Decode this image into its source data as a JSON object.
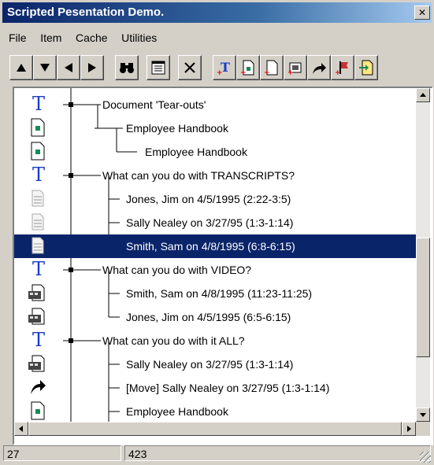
{
  "window": {
    "title": "Scripted Pesentation Demo.",
    "close_label": "✕"
  },
  "menu": [
    "File",
    "Item",
    "Cache",
    "Utilities"
  ],
  "toolbar": [
    {
      "name": "move-up-icon"
    },
    {
      "name": "move-down-icon"
    },
    {
      "name": "move-left-icon"
    },
    {
      "name": "move-right-icon"
    },
    {
      "name": "binoculars-icon"
    },
    {
      "name": "properties-icon"
    },
    {
      "name": "delete-icon"
    },
    {
      "name": "insert-text-icon"
    },
    {
      "name": "insert-document-icon"
    },
    {
      "name": "new-page-icon"
    },
    {
      "name": "insert-video-icon"
    },
    {
      "name": "move-arrow-icon"
    },
    {
      "name": "insert-flag-icon"
    },
    {
      "name": "export-icon"
    }
  ],
  "tree": [
    {
      "label": "Document 'Tear-outs'",
      "icon": "text-icon"
    },
    {
      "label": "Employee Handbook",
      "icon": "document-icon"
    },
    {
      "label": "Employee Handbook",
      "icon": "document-icon"
    },
    {
      "label": "What can you do with TRANSCRIPTS?",
      "icon": "text-icon"
    },
    {
      "label": "Jones, Jim on 4/5/1995 (2:22-3:5)",
      "icon": "transcript-icon"
    },
    {
      "label": "Sally Nealey on 3/27/95 (1:3-1:14)",
      "icon": "transcript-icon"
    },
    {
      "label": "Smith, Sam on 4/8/1995 (6:8-6:15)",
      "icon": "transcript-icon",
      "selected": true
    },
    {
      "label": "What can you do with VIDEO?",
      "icon": "text-icon"
    },
    {
      "label": "Smith, Sam on 4/8/1995 (11:23-11:25)",
      "icon": "video-icon"
    },
    {
      "label": "Jones, Jim on 4/5/1995 (6:5-6:15)",
      "icon": "video-icon"
    },
    {
      "label": "What can you do with it ALL?",
      "icon": "text-icon"
    },
    {
      "label": "Sally Nealey on 3/27/95 (1:3-1:14)",
      "icon": "video-icon"
    },
    {
      "label": "[Move] Sally Nealey on 3/27/95 (1:3-1:14)",
      "icon": "move-arrow-icon"
    },
    {
      "label": "Employee Handbook",
      "icon": "document-icon"
    }
  ],
  "status": {
    "left": "27",
    "right": "423"
  }
}
